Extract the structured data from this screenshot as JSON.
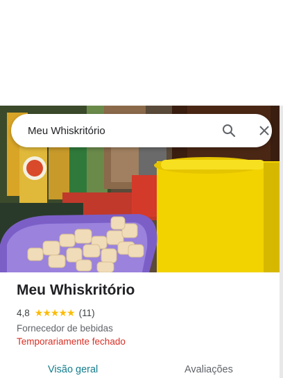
{
  "search": {
    "query": "Meu Whiskritório"
  },
  "place": {
    "name": "Meu Whiskritório",
    "rating": "4,8",
    "stars": 5,
    "review_count": "(11)",
    "category": "Fornecedor de bebidas",
    "status": "Temporariamente fechado"
  },
  "tabs": [
    {
      "label": "Visão geral",
      "active": true
    },
    {
      "label": "Avaliações",
      "active": false
    }
  ],
  "colors": {
    "star": "#fbbc04",
    "status_closed": "#d93025",
    "tab_active": "#137d8c"
  },
  "icons": [
    "search-icon",
    "close-icon",
    "star-icon"
  ]
}
